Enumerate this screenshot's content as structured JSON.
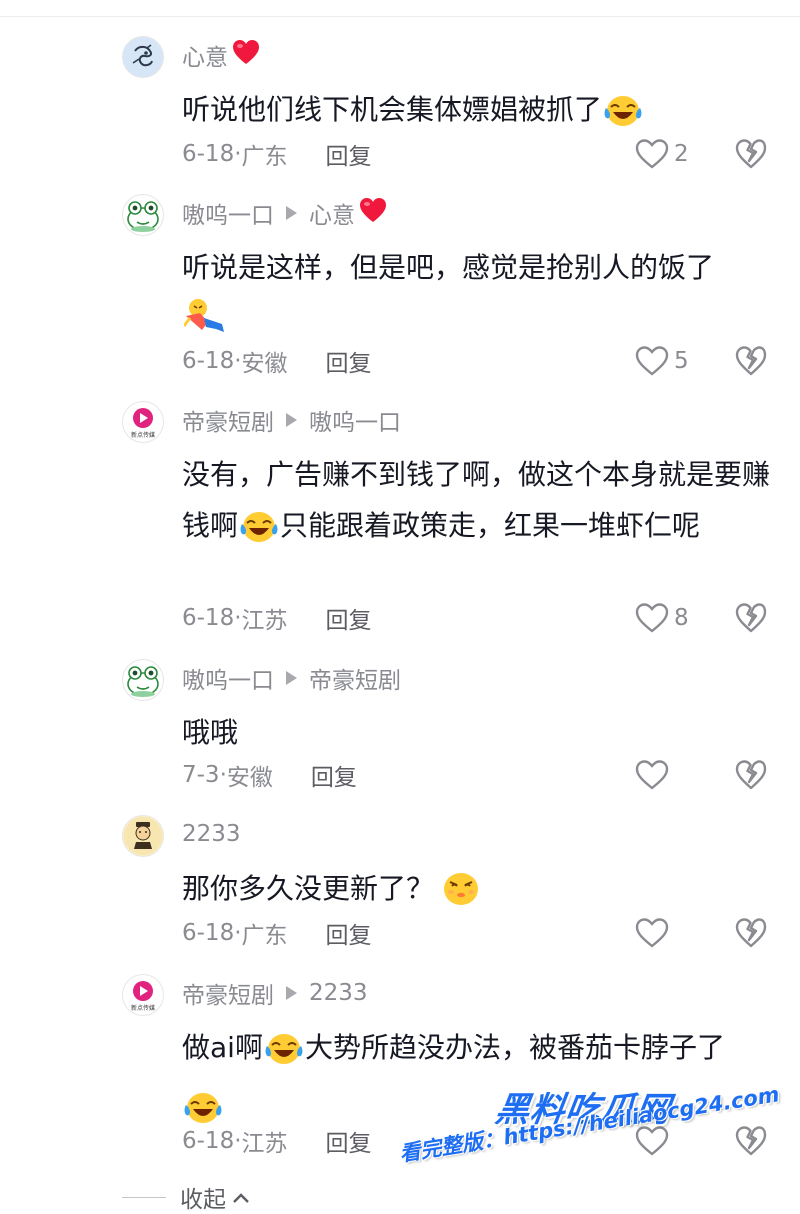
{
  "replies": [
    {
      "user": "心意",
      "user_suffix_emoji": "heart",
      "reply_to": "",
      "text_parts": [
        "听说他们线下机会集体嫖娼被抓了"
      ],
      "date": "6-18",
      "location": "广东",
      "reply_label": "回复",
      "likes": "2",
      "avatar": "avatar-sketch"
    },
    {
      "user": "嗷呜一口",
      "reply_to": "心意",
      "reply_to_emoji": "heart",
      "text_parts": [
        "听说是这样，但是吧，感觉是抢别人的饭了"
      ],
      "date": "6-18",
      "location": "安徽",
      "reply_label": "回复",
      "likes": "5",
      "avatar": "avatar-frog"
    },
    {
      "user": "帝豪短剧",
      "reply_to": "嗷呜一口",
      "text_parts": [
        "没有，广告赚不到钱了啊，做这个本身就是要赚钱啊",
        "只能跟着政策走，红果一堆虾仁呢"
      ],
      "date": "6-18",
      "location": "江苏",
      "reply_label": "回复",
      "likes": "8",
      "avatar": "avatar-play-logo",
      "avatar_text": "新点传媒"
    },
    {
      "user": "嗷呜一口",
      "reply_to": "帝豪短剧",
      "text_parts": [
        "哦哦"
      ],
      "date": "7-3",
      "location": "安徽",
      "reply_label": "回复",
      "likes": "",
      "avatar": "avatar-frog"
    },
    {
      "user": "2233",
      "reply_to": "",
      "text_parts": [
        "那你多久没更新了？"
      ],
      "date": "6-18",
      "location": "广东",
      "reply_label": "回复",
      "likes": "",
      "avatar": "avatar-cartoon"
    },
    {
      "user": "帝豪短剧",
      "reply_to": "2233",
      "text_parts": [
        "做ai啊",
        "大势所趋没办法，被番茄卡脖子了"
      ],
      "date": "6-18",
      "location": "江苏",
      "reply_label": "回复",
      "likes": "",
      "avatar": "avatar-play-logo",
      "avatar_text": "新点传媒"
    }
  ],
  "collapse_label": "收起",
  "watermark": {
    "title": "黑料吃瓜网",
    "subtitle": "看完整版：https://heiliaocg24.com"
  },
  "colors": {
    "text": "#161823",
    "meta": "#8a8b91",
    "heart": "#fe2c55",
    "watermark": "#1d6ef2"
  }
}
